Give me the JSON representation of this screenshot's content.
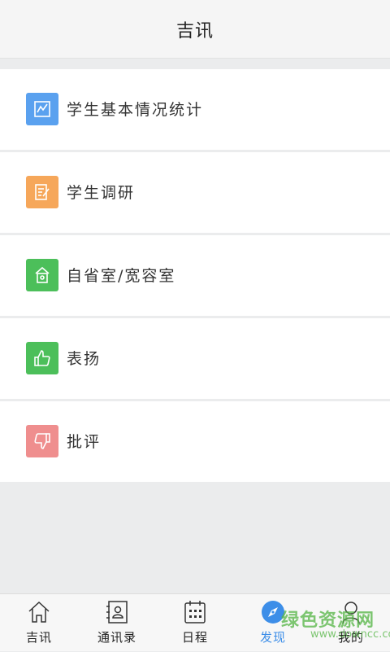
{
  "header": {
    "title": "吉讯"
  },
  "menu": {
    "items": [
      {
        "label": "学生基本情况统计",
        "icon": "chart-icon",
        "color": "#5aa1ef"
      },
      {
        "label": "学生调研",
        "icon": "edit-note-icon",
        "color": "#f6a75a"
      },
      {
        "label": "自省室/宽容室",
        "icon": "home-icon",
        "color": "#4cbf5a"
      },
      {
        "label": "表扬",
        "icon": "thumbs-up-icon",
        "color": "#4cbf5a"
      },
      {
        "label": "批评",
        "icon": "thumbs-down-icon",
        "color": "#ef8e8e"
      }
    ]
  },
  "tabbar": {
    "tabs": [
      {
        "label": "吉讯",
        "icon": "home-outline-icon"
      },
      {
        "label": "通讯录",
        "icon": "contacts-icon"
      },
      {
        "label": "日程",
        "icon": "calendar-icon"
      },
      {
        "label": "发现",
        "icon": "compass-icon",
        "active": true
      },
      {
        "label": "我的",
        "icon": "person-icon"
      }
    ],
    "active_color": "#3d8ee8"
  },
  "watermark": {
    "text": "绿色资源网",
    "url": "www.downcc.com"
  }
}
